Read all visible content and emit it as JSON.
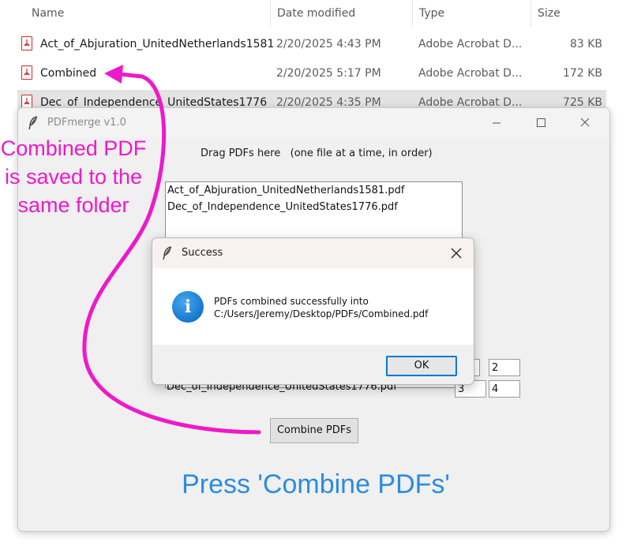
{
  "explorer": {
    "columns": {
      "name": "Name",
      "date": "Date modified",
      "type": "Type",
      "size": "Size"
    },
    "files": [
      {
        "name": "Act_of_Abjuration_UnitedNetherlands1581",
        "date": "2/20/2025 4:43 PM",
        "type": "Adobe Acrobat D...",
        "size": "83 KB",
        "icon": "pdf-file-icon"
      },
      {
        "name": "Combined",
        "date": "2/20/2025 5:17 PM",
        "type": "Adobe Acrobat D...",
        "size": "172 KB",
        "icon": "pdf-file-icon"
      },
      {
        "name": "Dec_of_Independence_UnitedStates1776",
        "date": "2/20/2025 4:35 PM",
        "type": "Adobe Acrobat D...",
        "size": "725 KB",
        "icon": "pdf-file-icon",
        "selected": true
      }
    ]
  },
  "app_window": {
    "title": "PDFmerge v1.0",
    "drag_label": "Drag PDFs here   (one file at a time, in order)",
    "listbox_items": [
      "Act_of_Abjuration_UnitedNetherlands1581.pdf",
      "Dec_of_Independence_UnitedStates1776.pdf"
    ],
    "order_row_label": "Dec_of_Independence_UnitedStates1776.pdf",
    "order_entries": [
      "2",
      "3",
      "4"
    ],
    "combine_button": "Combine PDFs"
  },
  "dialog": {
    "title": "Success",
    "message_line1": "PDFs combined successfully into",
    "message_line2": "C:/Users/Jeremy/Desktop/PDFs/Combined.pdf",
    "ok_button": "OK",
    "icon": "info-icon"
  },
  "annotations": {
    "left_text": [
      "Combined PDF",
      "is saved to the",
      "same folder"
    ],
    "bottom_text": "Press 'Combine PDFs'",
    "left_color": "#ee19cb",
    "bottom_color": "#2b8ce0"
  },
  "colors": {
    "pdf_icon": "#d3282b",
    "selected_row": "#e3e3e3",
    "accent": "#0078d7"
  }
}
